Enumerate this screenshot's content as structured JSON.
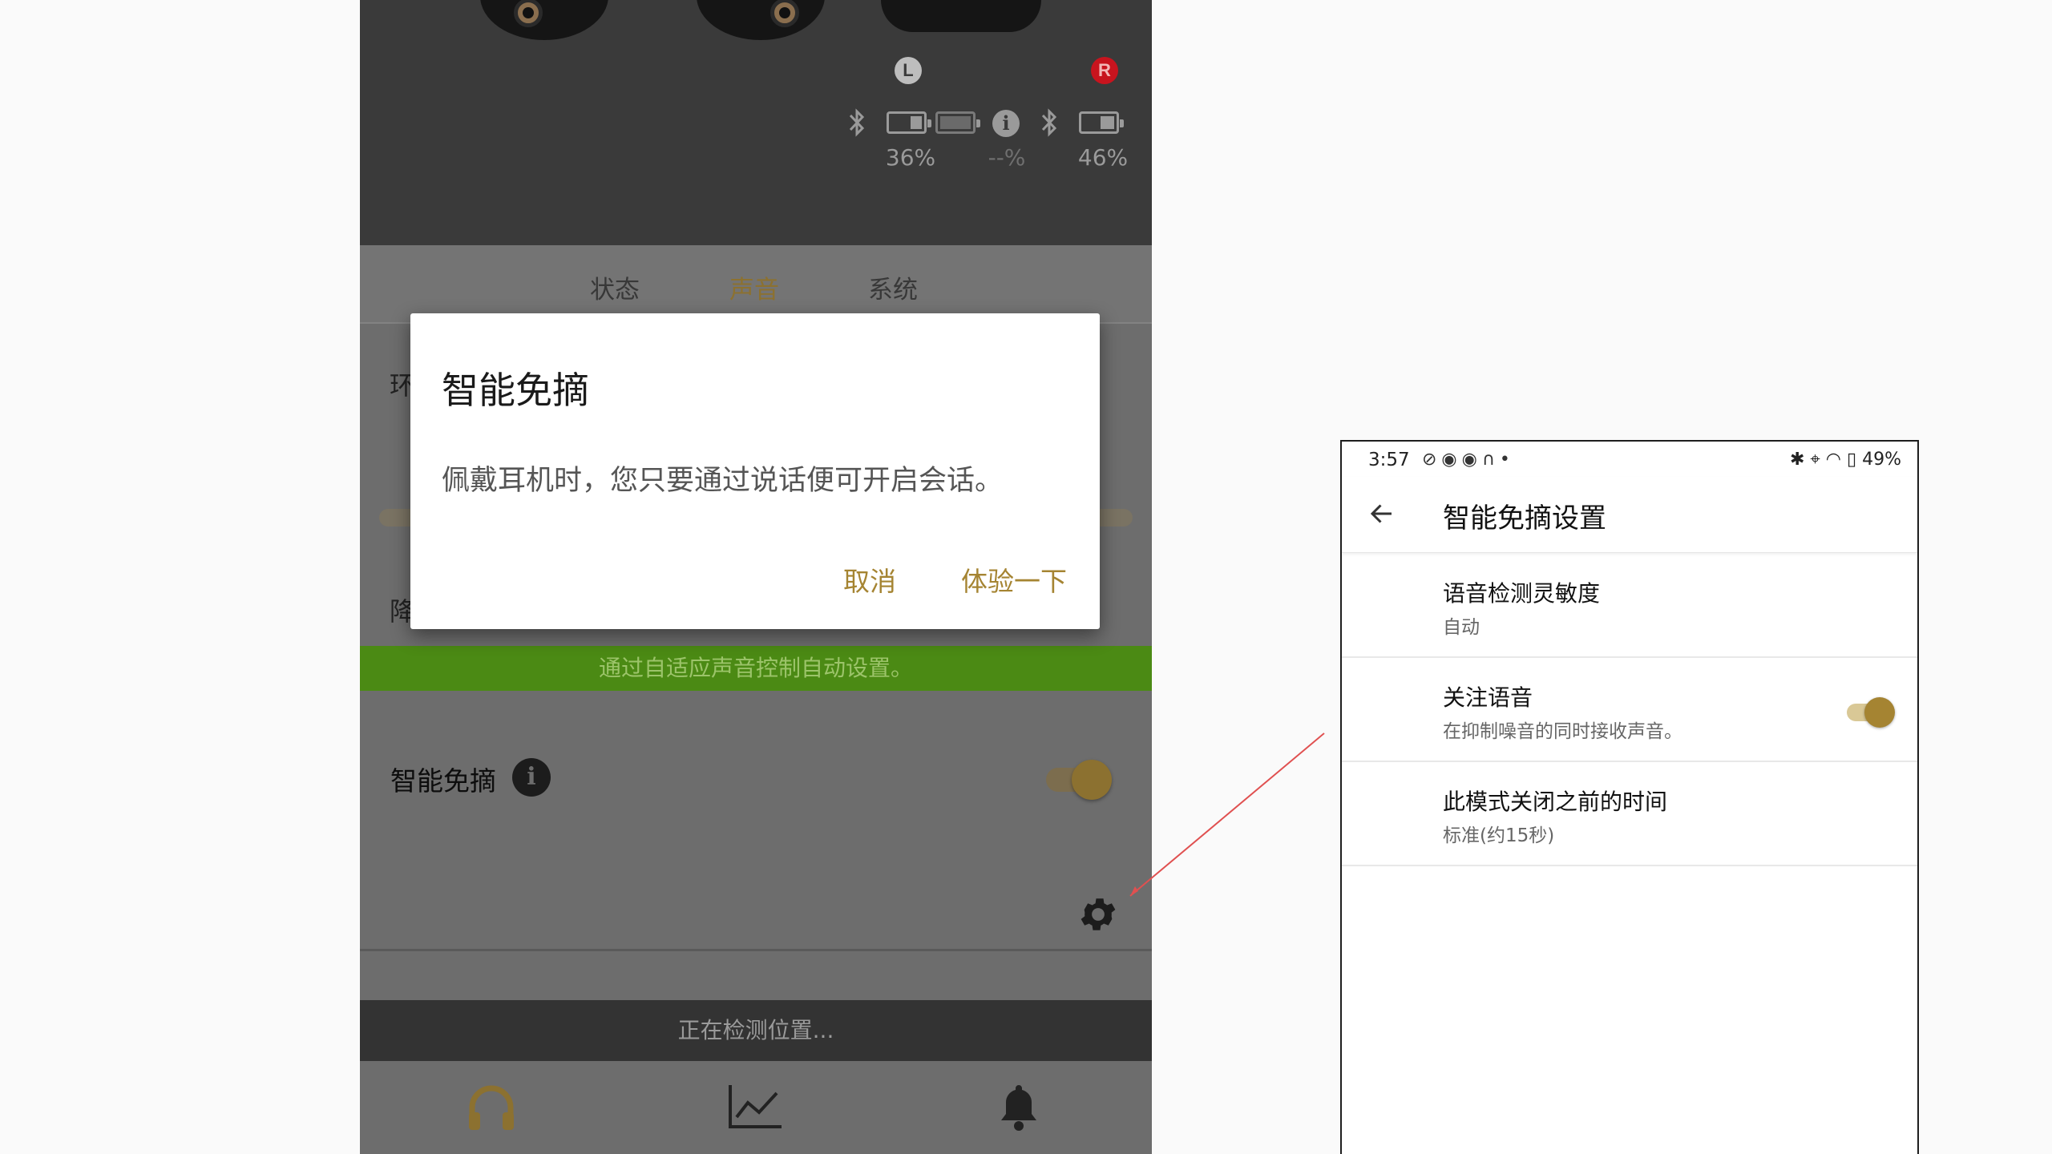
{
  "left_screen": {
    "earbuds": {
      "left": {
        "side_label": "L",
        "battery_percent": "36%",
        "battery_level": 0.36
      },
      "right": {
        "side_label": "R",
        "battery_percent": "46%",
        "battery_level": 0.46
      },
      "case": {
        "battery_percent": "--%"
      }
    },
    "tabs": [
      {
        "label": "状态",
        "active": false
      },
      {
        "label": "声音",
        "active": true
      },
      {
        "label": "系统",
        "active": false
      }
    ],
    "partial_labels": {
      "ambient": "环",
      "noise": "降"
    },
    "adaptive_banner": "通过自适应声音控制自动设置。",
    "speak_to_chat": {
      "label": "智能免摘",
      "info_glyph": "i",
      "enabled": true
    },
    "snackbar": "正在检测位置...",
    "bottom_nav": [
      {
        "icon": "headphones-icon",
        "label": "耳机"
      },
      {
        "icon": "activity-chart-icon",
        "label": "活动"
      },
      {
        "icon": "bell-icon",
        "label": "信息"
      }
    ],
    "dialog": {
      "title": "智能免摘",
      "body": "佩戴耳机时，您只要通过说话便可开启会话。",
      "cancel": "取消",
      "confirm": "体验一下"
    },
    "colors": {
      "accent": "#a58432",
      "banner": "#4b8a14"
    }
  },
  "right_screen": {
    "status_bar": {
      "time": "3:57",
      "battery": "49%"
    },
    "title": "智能免摘设置",
    "settings": [
      {
        "title": "语音检测灵敏度",
        "subtitle": "自动"
      },
      {
        "title": "关注语音",
        "subtitle": "在抑制噪音的同时接收声音。",
        "toggle_on": true
      },
      {
        "title": "此模式关闭之前的时间",
        "subtitle": "标准(约15秒)"
      }
    ]
  }
}
